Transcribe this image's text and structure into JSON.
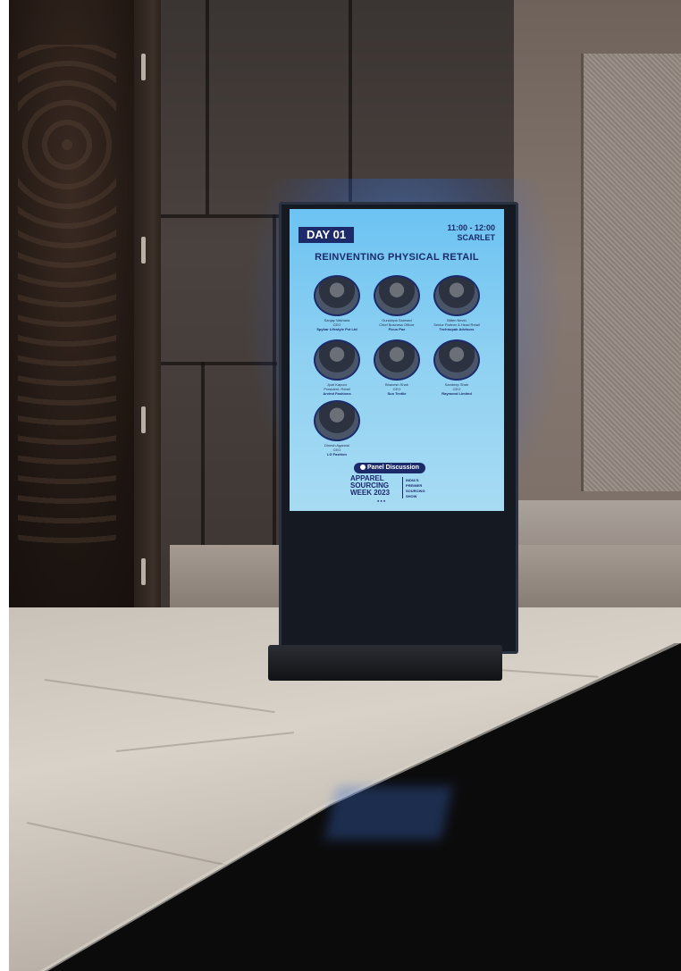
{
  "kiosk": {
    "day_label": "DAY 01",
    "time": "11:00 - 12:00",
    "room": "SCARLET",
    "session_title": "REINVENTING PHYSICAL RETAIL",
    "speakers": [
      {
        "name": "Sanjay Vakharia",
        "role": "CEO",
        "org": "Spykar Lifestyle Pvt Ltd"
      },
      {
        "name": "Gurukirpa Sarmani",
        "role": "Chief Business Officer",
        "org": "Ficus Pax"
      },
      {
        "name": "Bitten Nevin",
        "role": "Senior Partner & Head Retail",
        "org": "Technopak Advisors"
      },
      {
        "name": "Jyoti Kapoor",
        "role": "President, Retail",
        "org": "Arvind Fashions"
      },
      {
        "name": "Bhavesh Shah",
        "role": "CEO",
        "org": "Sun Textile"
      },
      {
        "name": "Sandeep Shah",
        "role": "CEO",
        "org": "Raymond Limited"
      },
      {
        "name": "Dinesh Agarwal",
        "role": "CEO",
        "org": "LG Fashion"
      }
    ],
    "panel_label": "Panel Discussion",
    "logo": {
      "line1": "APPAREL",
      "line2": "SOURCING",
      "line3": "WEEK 2023",
      "tagline1": "INDIA'S",
      "tagline2": "PREMIER",
      "tagline3": "SOURCING",
      "tagline4": "SHOW"
    }
  }
}
